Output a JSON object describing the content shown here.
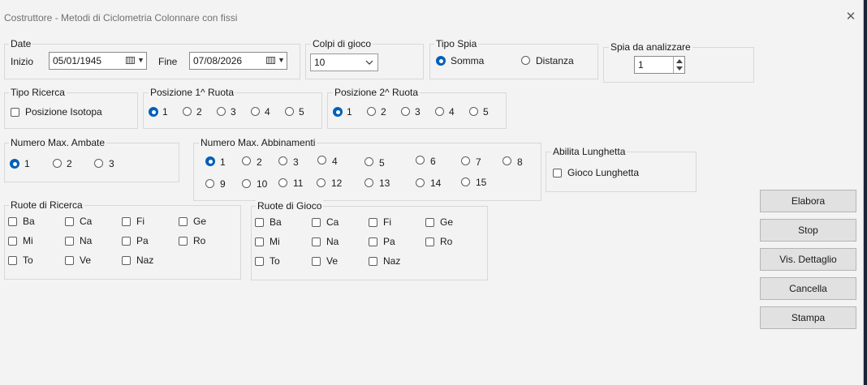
{
  "window": {
    "title": "Costruttore - Metodi di Ciclometria Colonnare con fissi",
    "close_glyph": "✕"
  },
  "date": {
    "group": "Date",
    "start_label": "Inizio",
    "start_value": "05/01/1945",
    "end_label": "Fine",
    "end_value": "07/08/2026"
  },
  "colpi": {
    "group": "Colpi di gioco",
    "value": "10"
  },
  "tipo_spia": {
    "group": "Tipo Spia",
    "options": [
      "Somma",
      "Distanza"
    ],
    "selected": "Somma"
  },
  "spia": {
    "group": "Spia da analizzare",
    "value": "1"
  },
  "tipo_ricerca": {
    "group": "Tipo Ricerca",
    "checkbox_label": "Posizione Isotopa"
  },
  "pos1": {
    "group": "Posizione 1^ Ruota",
    "options": [
      "1",
      "2",
      "3",
      "4",
      "5"
    ],
    "selected": "1"
  },
  "pos2": {
    "group": "Posizione 2^ Ruota",
    "options": [
      "1",
      "2",
      "3",
      "4",
      "5"
    ],
    "selected": "1"
  },
  "ambate": {
    "group": "Numero Max. Ambate",
    "options": [
      "1",
      "2",
      "3"
    ],
    "selected": "1"
  },
  "abbinamenti": {
    "group": "Numero Max. Abbinamenti",
    "options": [
      "1",
      "2",
      "3",
      "4",
      "5",
      "6",
      "7",
      "8",
      "9",
      "10",
      "11",
      "12",
      "13",
      "14",
      "15"
    ],
    "selected": "1"
  },
  "lunghetta": {
    "group": "Abilita Lunghetta",
    "checkbox_label": "Gioco Lunghetta"
  },
  "ruote_ricerca": {
    "group": "Ruote di Ricerca",
    "items": [
      "Ba",
      "Ca",
      "Fi",
      "Ge",
      "Mi",
      "Na",
      "Pa",
      "Ro",
      "To",
      "Ve",
      "Naz"
    ]
  },
  "ruote_gioco": {
    "group": "Ruote di Gioco",
    "items": [
      "Ba",
      "Ca",
      "Fi",
      "Ge",
      "Mi",
      "Na",
      "Pa",
      "Ro",
      "To",
      "Ve",
      "Naz"
    ]
  },
  "buttons": {
    "elabora": "Elabora",
    "stop": "Stop",
    "dettaglio": "Vis. Dettaglio",
    "cancella": "Cancella",
    "stampa": "Stampa"
  },
  "colors": {
    "accent": "#005fb8",
    "window_bg": "#f3f3f3",
    "button_bg": "#e1e1e1"
  }
}
